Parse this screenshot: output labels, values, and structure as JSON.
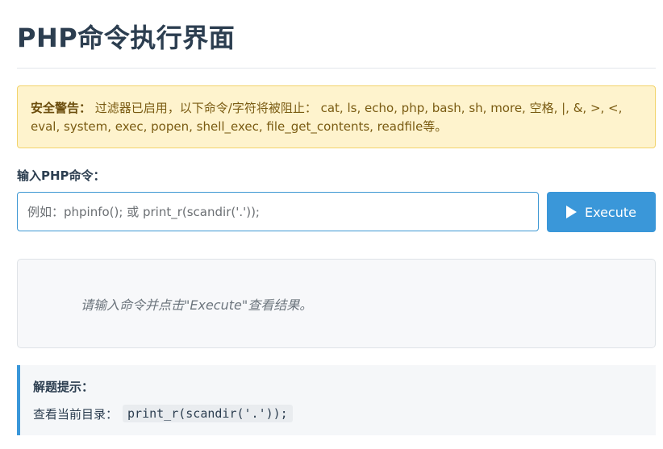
{
  "page": {
    "title": "PHP命令执行界面"
  },
  "warning": {
    "label": "安全警告：",
    "text": " 过滤器已启用，以下命令/字符将被阻止： cat, ls, echo, php, bash, sh, more, 空格, |, &, >, <, eval, system, exec, popen, shell_exec, file_get_contents, readfile等。"
  },
  "command": {
    "label": "输入PHP命令：",
    "placeholder": "例如：phpinfo(); 或 print_r(scandir('.'));",
    "value": ""
  },
  "execute_button": {
    "label": "Execute",
    "icon": "play-icon"
  },
  "result": {
    "placeholder": "请输入命令并点击\"Execute\"查看结果。"
  },
  "hint": {
    "title": "解题提示：",
    "label": "查看当前目录：",
    "code": "print_r(scandir('.'));"
  },
  "colors": {
    "accent": "#3a97d9",
    "warning_bg": "#fef3cd",
    "warning_border": "#f2d36b",
    "title": "#2c3e50"
  }
}
